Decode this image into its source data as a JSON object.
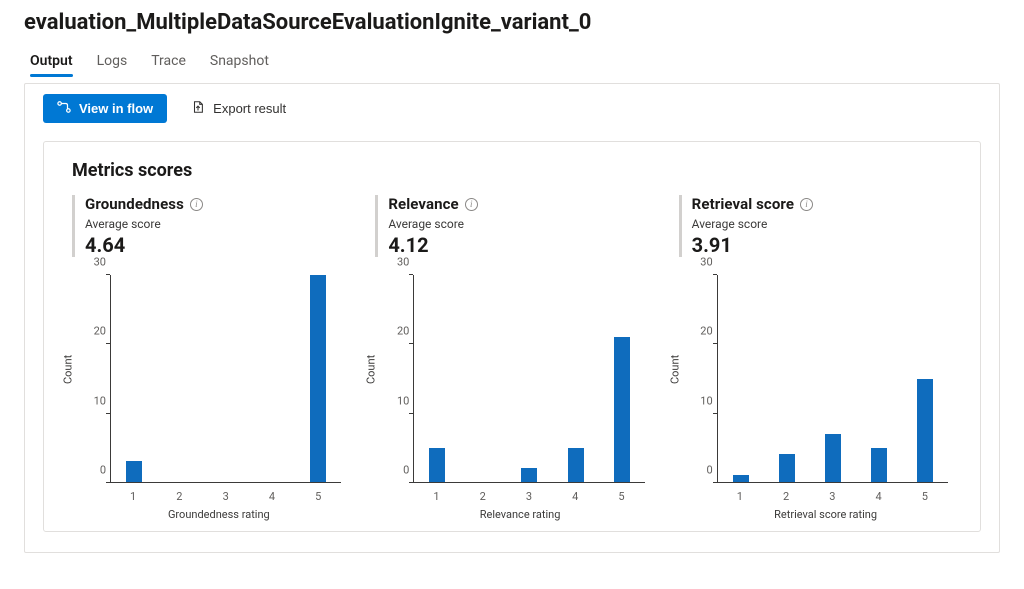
{
  "page_title": "evaluation_MultipleDataSourceEvaluationIgnite_variant_0",
  "tabs": [
    "Output",
    "Logs",
    "Trace",
    "Snapshot"
  ],
  "active_tab_index": 0,
  "toolbar": {
    "view_in_flow": "View in flow",
    "export_result": "Export result"
  },
  "section_title": "Metrics scores",
  "avg_label": "Average score",
  "ylabel": "Count",
  "metrics": [
    {
      "title": "Groundedness",
      "avg": "4.64",
      "xlabel": "Groundedness rating"
    },
    {
      "title": "Relevance",
      "avg": "4.12",
      "xlabel": "Relevance rating"
    },
    {
      "title": "Retrieval score",
      "avg": "3.91",
      "xlabel": "Retrieval score rating"
    }
  ],
  "chart_data": [
    {
      "type": "bar",
      "title": "Groundedness",
      "xlabel": "Groundedness rating",
      "ylabel": "Count",
      "ylim": [
        0,
        30
      ],
      "yticks": [
        0,
        10,
        20,
        30
      ],
      "categories": [
        "1",
        "2",
        "3",
        "4",
        "5"
      ],
      "values": [
        3,
        0,
        0,
        0,
        30
      ]
    },
    {
      "type": "bar",
      "title": "Relevance",
      "xlabel": "Relevance rating",
      "ylabel": "Count",
      "ylim": [
        0,
        30
      ],
      "yticks": [
        0,
        10,
        20,
        30
      ],
      "categories": [
        "1",
        "2",
        "3",
        "4",
        "5"
      ],
      "values": [
        5,
        0,
        2,
        5,
        21
      ]
    },
    {
      "type": "bar",
      "title": "Retrieval score",
      "xlabel": "Retrieval score rating",
      "ylabel": "Count",
      "ylim": [
        0,
        30
      ],
      "yticks": [
        0,
        10,
        20,
        30
      ],
      "categories": [
        "1",
        "2",
        "3",
        "4",
        "5"
      ],
      "values": [
        1,
        4,
        7,
        5,
        15
      ]
    }
  ]
}
